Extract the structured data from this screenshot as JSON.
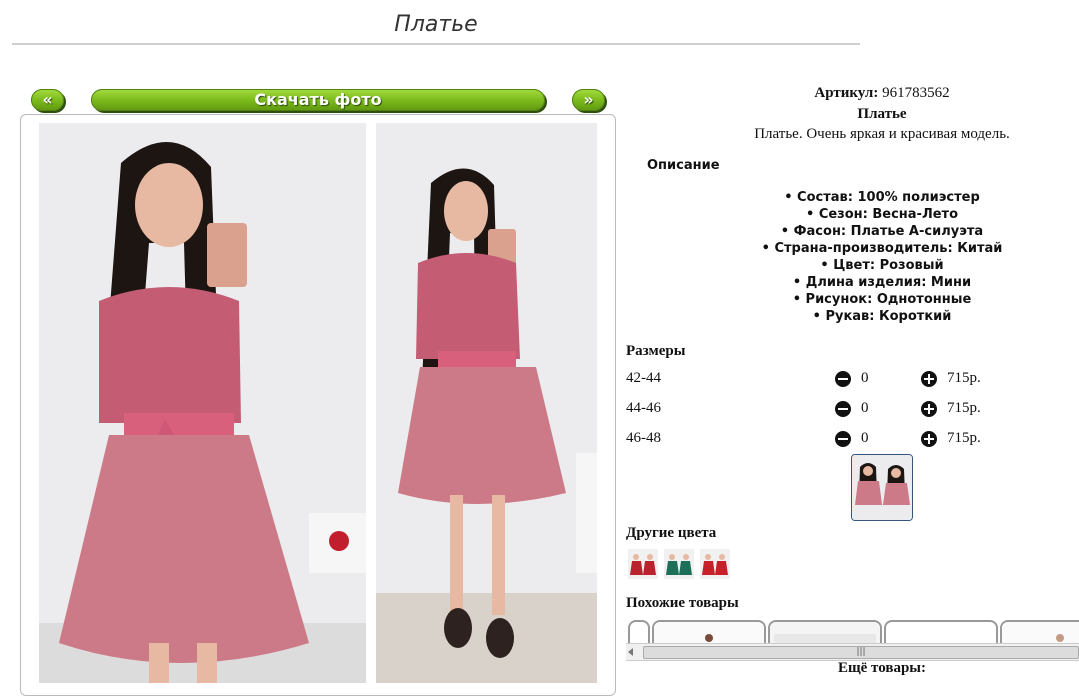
{
  "page": {
    "title": "Платье"
  },
  "gallery": {
    "prev_label": "«",
    "download_label": "Скачать фото",
    "next_label": "»"
  },
  "product": {
    "article_label": "Артикул:",
    "article_value": "961783562",
    "name": "Платье",
    "short_description": "Платье. Очень яркая и красивая модель.",
    "description_heading": "Описание",
    "features": [
      "Состав: 100% полиэстер",
      "Сезон: Весна-Лето",
      "Фасон: Платье А-силуэта",
      "Страна-производитель: Китай",
      "Цвет: Розовый",
      "Длина изделия: Мини",
      "Рисунок: Однотонные",
      "Рукав: Короткий"
    ]
  },
  "sizes": {
    "heading": "Размеры",
    "rows": [
      {
        "size": "42-44",
        "qty": "0",
        "price": "715р."
      },
      {
        "size": "44-46",
        "qty": "0",
        "price": "715р."
      },
      {
        "size": "46-48",
        "qty": "0",
        "price": "715р."
      }
    ]
  },
  "other_colors": {
    "heading": "Другие цвета",
    "items": [
      {
        "color_name": "red",
        "hex": "#b8232e"
      },
      {
        "color_name": "green",
        "hex": "#1d6f5a"
      },
      {
        "color_name": "red",
        "hex": "#c8202b"
      }
    ]
  },
  "similar": {
    "heading": "Похожие товары",
    "scroll_grip": "|||",
    "more_heading": "Ещё товары:"
  },
  "colors": {
    "button_green": "#7cbb1d",
    "dress_pink": "#c9667d",
    "selected_border": "#35557a"
  }
}
